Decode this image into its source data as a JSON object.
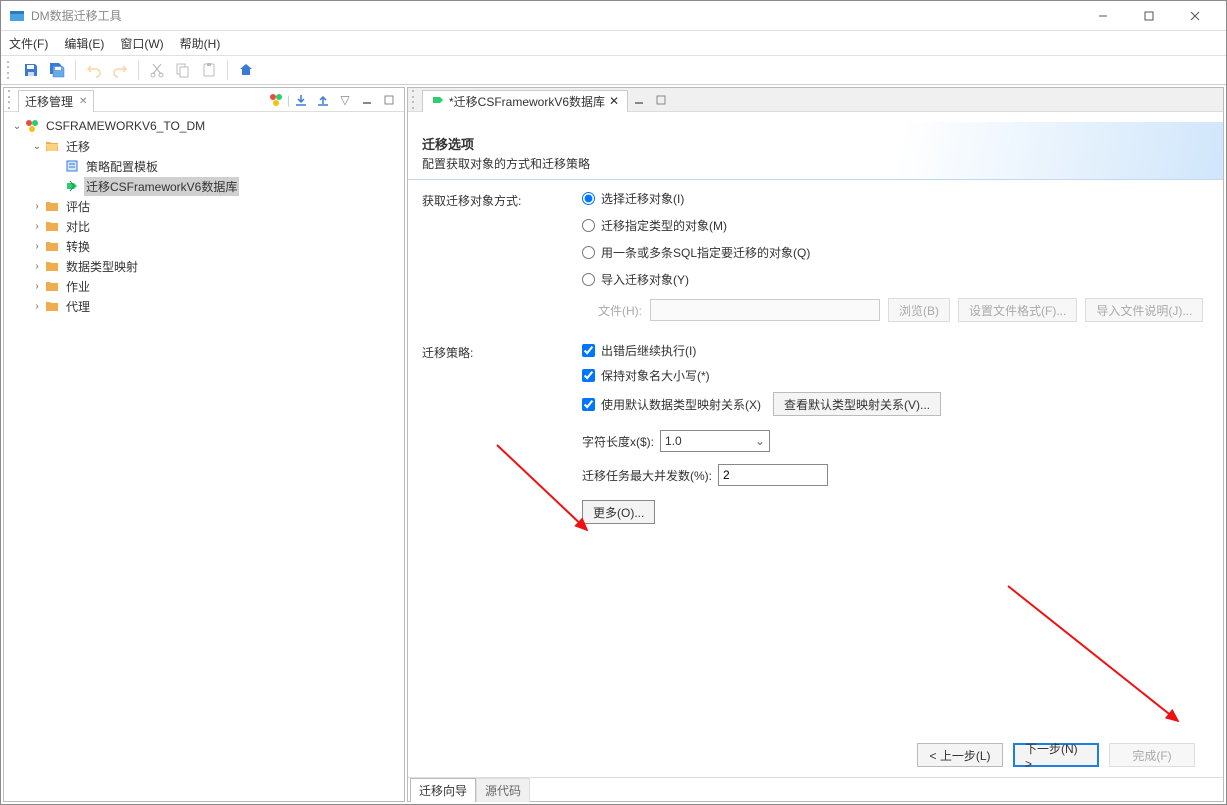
{
  "window": {
    "title": "DM数据迁移工具"
  },
  "menubar": {
    "file": "文件(F)",
    "edit": "编辑(E)",
    "window": "窗口(W)",
    "help": "帮助(H)"
  },
  "left": {
    "tab": "迁移管理",
    "tree": {
      "root": "CSFRAMEWORKV6_TO_DM",
      "migrate": "迁移",
      "template": "策略配置模板",
      "task": "迁移CSFrameworkV6数据库",
      "evaluate": "评估",
      "compare": "对比",
      "convert": "转换",
      "typemap": "数据类型映射",
      "job": "作业",
      "proxy": "代理"
    }
  },
  "editor": {
    "tab": "*迁移CSFrameworkV6数据库"
  },
  "page": {
    "title": "迁移选项",
    "subtitle": "配置获取对象的方式和迁移策略",
    "section_mode": "获取迁移对象方式:",
    "radios": {
      "select": "选择迁移对象(I)",
      "bytype": "迁移指定类型的对象(M)",
      "bysql": "用一条或多条SQL指定要迁移的对象(Q)",
      "import": "导入迁移对象(Y)"
    },
    "file": {
      "label": "文件(H):",
      "value": "",
      "browse": "浏览(B)",
      "setfmt": "设置文件格式(F)...",
      "importdesc": "导入文件说明(J)..."
    },
    "section_strategy": "迁移策略:",
    "checks": {
      "continue": "出错后继续执行(I)",
      "keepcase": "保持对象名大小写(*)",
      "defaulttypemap": "使用默认数据类型映射关系(X)"
    },
    "viewtypemap": "查看默认类型映射关系(V)...",
    "charlen": {
      "label": "字符长度x($):",
      "value": "1.0"
    },
    "concurrency": {
      "label": "迁移任务最大并发数(%):",
      "value": "2"
    },
    "more": "更多(O)...",
    "nav": {
      "prev": "< 上一步(L)",
      "next": "下一步(N) >",
      "finish": "完成(F)"
    },
    "footer": {
      "wizard": "迁移向导",
      "source": "源代码"
    }
  }
}
